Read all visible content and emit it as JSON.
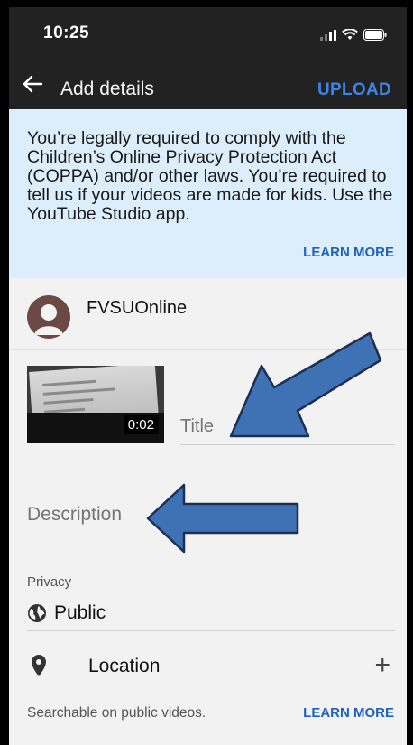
{
  "status_bar": {
    "time": "10:25"
  },
  "app_bar": {
    "title": "Add details",
    "upload_label": "UPLOAD"
  },
  "banner": {
    "text": "You’re legally required to comply with the Children’s Online Privacy Protection Act (COPPA) and/or other laws. You’re required to tell us if your videos are made for kids. Use the YouTube Studio app.",
    "learn_more": "LEARN MORE"
  },
  "channel": {
    "name": "FVSUOnline"
  },
  "video": {
    "duration": "0:02",
    "title_placeholder": "Title"
  },
  "description": {
    "placeholder": "Description"
  },
  "privacy": {
    "label": "Privacy",
    "value": "Public"
  },
  "location": {
    "label": "Location",
    "add_icon": "+"
  },
  "footer": {
    "note": "Searchable on public videos.",
    "learn_more": "LEARN MORE"
  },
  "icons": [
    "signal-icon",
    "wifi-icon",
    "battery-icon",
    "back-arrow-icon",
    "avatar-icon",
    "globe-icon",
    "location-pin-icon",
    "plus-icon"
  ],
  "colors": {
    "accent": "#3d84e8",
    "link": "#1f62bd",
    "banner": "#dceefb",
    "annotation_arrow": "#3f72b5"
  }
}
